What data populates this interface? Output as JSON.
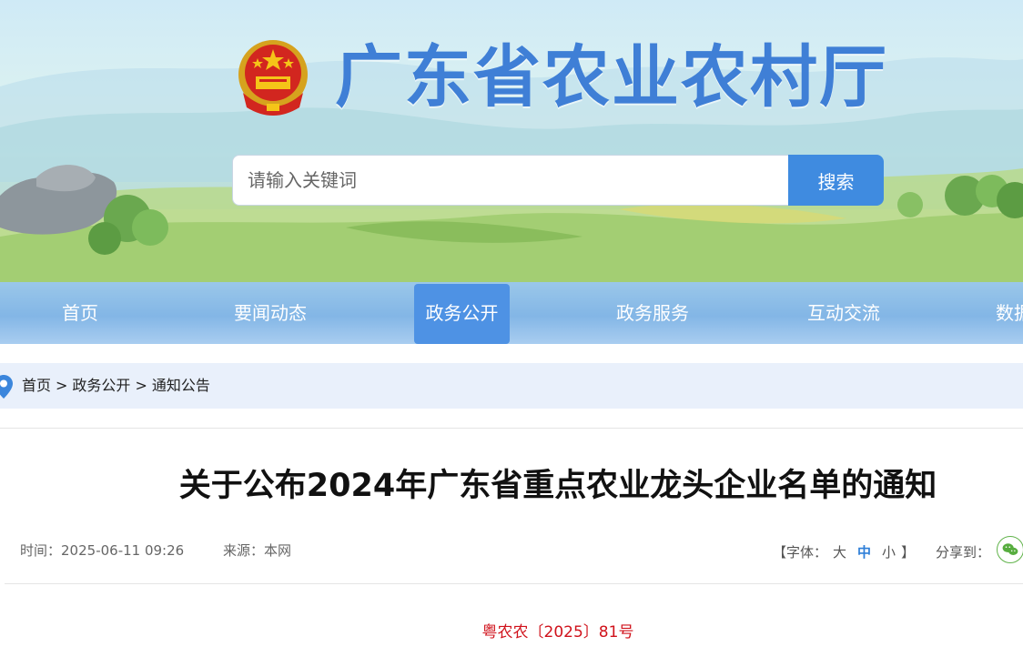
{
  "header": {
    "site_title": "广东省农业农村厅",
    "emblem": "national-emblem"
  },
  "search": {
    "placeholder": "请输入关键词",
    "value": "",
    "button_label": "搜索"
  },
  "nav": {
    "items": [
      {
        "label": "首页",
        "active": false
      },
      {
        "label": "要闻动态",
        "active": false
      },
      {
        "label": "政务公开",
        "active": true
      },
      {
        "label": "政务服务",
        "active": false
      },
      {
        "label": "互动交流",
        "active": false
      },
      {
        "label": "数据",
        "active": false
      }
    ]
  },
  "breadcrumb": {
    "icon": "location-pin-icon",
    "items": [
      "首页",
      "政务公开",
      "通知公告"
    ],
    "separator": ">"
  },
  "article": {
    "title": "关于公布2024年广东省重点农业龙头企业名单的通知",
    "time_label": "时间：",
    "time": "2025-06-11 09:26",
    "source_label": "来源：",
    "source": "本网",
    "font_label_open": "【字体：",
    "font_large": "大",
    "font_medium": "中",
    "font_small": "小",
    "font_label_close": "】",
    "share_label": "分享到：",
    "share_icon": "wechat-icon",
    "doc_number": "粤农农〔2025〕81号"
  },
  "colors": {
    "brand_blue": "#3f7fd6",
    "nav_active": "#4e92e4",
    "doc_number_red": "#d0121b"
  }
}
